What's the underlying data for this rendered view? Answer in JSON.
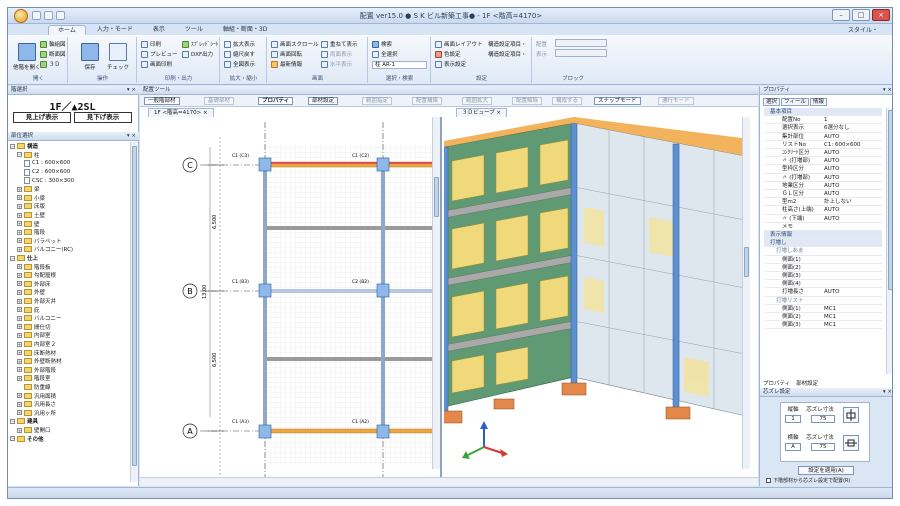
{
  "window": {
    "title": "配置 ver15.0 ● S K ビル新築工事● - 1F <階高=4170>",
    "buttons": {
      "minimize": "–",
      "maximize": "□",
      "close": "×"
    }
  },
  "ribbon": {
    "tabs": [
      "ホーム",
      "入力・モード",
      "表示",
      "ツール",
      "軸組・断面・3D"
    ],
    "style_label": "スタイル・",
    "groups": {
      "open": {
        "label": "開く",
        "items": [
          "軸組図",
          "断面図",
          "３Ｄ"
        ],
        "big": "他階を開く"
      },
      "operate": {
        "label": "操作",
        "items": [
          "保存",
          "チェック"
        ]
      },
      "print": {
        "label": "印刷・出力",
        "items": [
          "印刷",
          "プレビュー",
          "画面印刷",
          "ｽﾌﾟﾚｯﾄﾞｼｰﾄ",
          "DXF出力"
        ]
      },
      "zoom": {
        "label": "拡大・縮小",
        "items": [
          "拡大表示",
          "縮尺戻す",
          "全図表示"
        ]
      },
      "screen": {
        "label": "画面",
        "items": [
          "画面スクロール",
          "画面回転",
          "最新情報",
          "重ねて表示",
          "両面表示",
          "水平表示"
        ]
      },
      "select": {
        "label": "選択・検索",
        "items": [
          "検索",
          "全選択"
        ],
        "combo": "柱 AR-1"
      },
      "settings": {
        "label": "設定",
        "items": [
          "画面レイアウト",
          "色設定",
          "表示設定",
          "構造設定項目・",
          "構造設定項目・"
        ]
      },
      "block": {
        "label": "ブロック",
        "fields": [
          "配置",
          "表示"
        ]
      }
    }
  },
  "left_panel": {
    "title": "階選択",
    "floor_title": "1F／▲2SL",
    "btn_top": "見上げ表示",
    "btn_bottom": "見下げ表示",
    "tree_title": "部位選択",
    "tree": [
      {
        "label": "構造",
        "level": 0,
        "toggle": "−"
      },
      {
        "label": "柱",
        "level": 1,
        "toggle": "−"
      },
      {
        "label": "C1 : 600×600",
        "level": 2,
        "type": "doc"
      },
      {
        "label": "C2 : 600×600",
        "level": 2,
        "type": "doc"
      },
      {
        "label": "CSC : 300×300",
        "level": 2,
        "type": "doc"
      },
      {
        "label": "梁",
        "level": 1,
        "toggle": "+"
      },
      {
        "label": "小梁",
        "level": 1,
        "toggle": "+"
      },
      {
        "label": "床版",
        "level": 1,
        "toggle": "+"
      },
      {
        "label": "土壁",
        "level": 1,
        "toggle": "+"
      },
      {
        "label": "壁",
        "level": 1,
        "toggle": "+"
      },
      {
        "label": "階段",
        "level": 1,
        "toggle": "+"
      },
      {
        "label": "パラペット",
        "level": 1,
        "toggle": "+"
      },
      {
        "label": "バルコニー(RC)",
        "level": 1,
        "toggle": "+"
      },
      {
        "label": "仕上",
        "level": 0,
        "toggle": "−"
      },
      {
        "label": "階段板",
        "level": 1,
        "toggle": "+"
      },
      {
        "label": "勾配屋根",
        "level": 1,
        "toggle": "+"
      },
      {
        "label": "外部床",
        "level": 1,
        "toggle": "+"
      },
      {
        "label": "外壁",
        "level": 1,
        "toggle": "+"
      },
      {
        "label": "外部天井",
        "level": 1,
        "toggle": "+"
      },
      {
        "label": "庇",
        "level": 1,
        "toggle": "+"
      },
      {
        "label": "バルコニー",
        "level": 1,
        "toggle": "+"
      },
      {
        "label": "間仕切",
        "level": 1,
        "toggle": "+"
      },
      {
        "label": "内部室",
        "level": 1,
        "toggle": "+"
      },
      {
        "label": "内部室２",
        "level": 1,
        "toggle": "+"
      },
      {
        "label": "床断熱材",
        "level": 1,
        "toggle": "+"
      },
      {
        "label": "外壁断熱材",
        "level": 1,
        "toggle": "+"
      },
      {
        "label": "外部階段",
        "level": 1,
        "toggle": "+"
      },
      {
        "label": "階段室",
        "level": 1,
        "toggle": "+"
      },
      {
        "label": "防重線",
        "level": 1,
        "toggle": ""
      },
      {
        "label": "汎用面積",
        "level": 1,
        "toggle": "+"
      },
      {
        "label": "汎用長さ",
        "level": 1,
        "toggle": "+"
      },
      {
        "label": "汎用ヶ所",
        "level": 1,
        "toggle": "+"
      },
      {
        "label": "建具",
        "level": 0,
        "toggle": "−"
      },
      {
        "label": "壁開口",
        "level": 1,
        "toggle": "+"
      },
      {
        "label": "その他",
        "level": 0,
        "toggle": "−"
      }
    ]
  },
  "center": {
    "panel_title": "配置ツール",
    "toolbar": [
      "一般階部材",
      "基礎部材",
      "プロパティ",
      "部材設定",
      "範囲指定",
      "配置構築",
      "範囲拡大",
      "配置解除",
      "構成する",
      "スナップモード",
      "通行モード"
    ],
    "doc_tabs": [
      "1F <階高=4170>",
      "３Ｄビュープ"
    ],
    "plan": {
      "row_labels": [
        "C",
        "B",
        "A"
      ],
      "columns": [
        "C1 (C3)",
        "C1 (C2)",
        "C1 (B3)",
        "C2 (B2)",
        "C1 (A3)",
        "C1 (A2)"
      ],
      "dims": [
        "6,500",
        "13,00",
        "6,500"
      ]
    }
  },
  "right_panel": {
    "title": "プロパティ",
    "tabs": [
      "選択",
      "フィール",
      "情報"
    ],
    "rows": [
      {
        "type": "section",
        "k": "基本項目",
        "v": ""
      },
      {
        "type": "row",
        "k": "配置No",
        "v": "1"
      },
      {
        "type": "row",
        "k": "選択表示",
        "v": "6選分なし"
      },
      {
        "type": "row",
        "k": "集計部位",
        "v": "AUTO"
      },
      {
        "type": "row",
        "k": "リストNo",
        "v": "C1: 600×600"
      },
      {
        "type": "row",
        "k": "ｺﾝｸﾘｰﾄ区分",
        "v": "AUTO"
      },
      {
        "type": "row",
        "k": "〃 (打増部)",
        "v": "AUTO"
      },
      {
        "type": "row",
        "k": "型枠区分",
        "v": "AUTO"
      },
      {
        "type": "row",
        "k": "〃 (打増部)",
        "v": "AUTO"
      },
      {
        "type": "row",
        "k": "地業区分",
        "v": "AUTO"
      },
      {
        "type": "row",
        "k": "ＧＬ区分",
        "v": "AUTO"
      },
      {
        "type": "row",
        "k": "型m2",
        "v": "計上しない"
      },
      {
        "type": "row",
        "k": "柱高さ(上端)",
        "v": "AUTO"
      },
      {
        "type": "row",
        "k": "〃 (下端)",
        "v": "AUTO"
      },
      {
        "type": "row",
        "k": "メモ",
        "v": ""
      },
      {
        "type": "section",
        "k": "表示情報",
        "v": ""
      },
      {
        "type": "section",
        "k": "打増し",
        "v": ""
      },
      {
        "type": "sub",
        "k": "打増しあま",
        "v": ""
      },
      {
        "type": "row",
        "k": "側面(1)",
        "v": ""
      },
      {
        "type": "row",
        "k": "側面(2)",
        "v": ""
      },
      {
        "type": "row",
        "k": "側面(3)",
        "v": ""
      },
      {
        "type": "row",
        "k": "側面(4)",
        "v": ""
      },
      {
        "type": "row",
        "k": "打増長さ",
        "v": "AUTO"
      },
      {
        "type": "sub",
        "k": "打増リスト",
        "v": ""
      },
      {
        "type": "row",
        "k": "側面(1)",
        "v": "MC1"
      },
      {
        "type": "row",
        "k": "側面(2)",
        "v": "MC1"
      },
      {
        "type": "row",
        "k": "側面(3)",
        "v": "MC1"
      }
    ],
    "bottom_tabs": [
      "プロパティ",
      "部材設定"
    ],
    "offset": {
      "title": "芯ズレ設定",
      "x_label": "縦軸",
      "x_val": "1",
      "x_off_label": "芯ズレ寸法",
      "x_off_val": "75",
      "y_label": "横軸",
      "y_val": "A",
      "y_off_label": "芯ズレ寸法",
      "y_off_val": "75",
      "apply": "設定を適用(A)",
      "checkbox": "下階部材から芯ズレ設定で配置(R)"
    }
  }
}
